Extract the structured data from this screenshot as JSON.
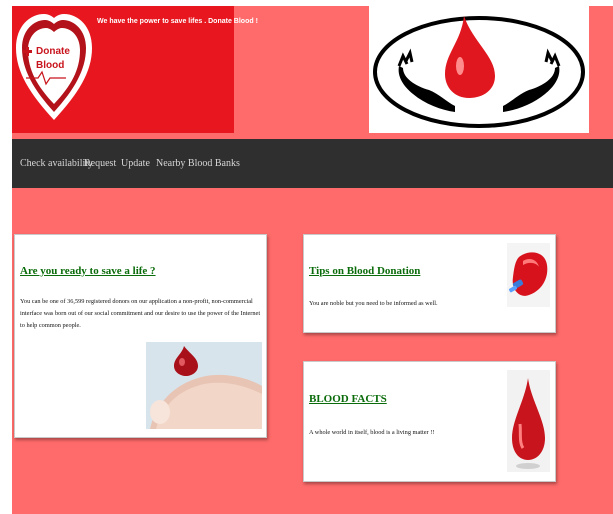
{
  "header": {
    "tagline": "We have the power to save lifes . Donate Blood !",
    "logo_text_1": "Donate",
    "logo_text_2": "Blood"
  },
  "nav": {
    "items": [
      {
        "label": "Check availability"
      },
      {
        "label": "Request"
      },
      {
        "label": "Update"
      },
      {
        "label": "Nearby Blood Banks"
      }
    ]
  },
  "cards": {
    "ready": {
      "title": "Are you ready to save a life ?",
      "body": "You can be one of 36,599 registered donors on our application a non-profit, non-commercial interface was born out of our social commitment and our desire to use the power of the Internet to help common people."
    },
    "tips": {
      "title": "Tips on Blood Donation",
      "body": "You are noble but you need to be informed as well."
    },
    "facts": {
      "title": "BLOOD FACTS",
      "body": "A whole world in itself, blood is a living matter !!"
    }
  },
  "colors": {
    "page_bg": "#ff6b6b",
    "banner_red": "#e8171f",
    "nav_bg": "#2f2f2f",
    "heading_green": "#0a6b0a"
  }
}
